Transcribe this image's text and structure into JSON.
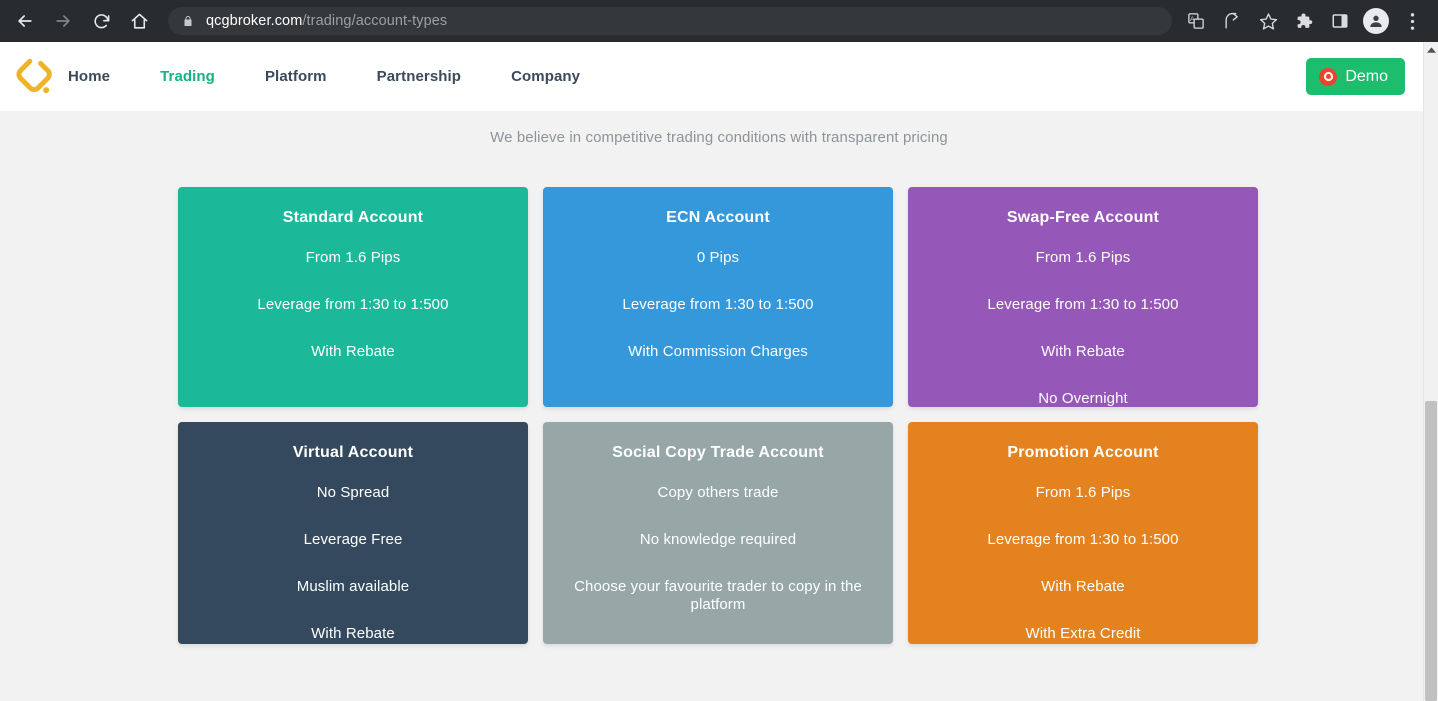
{
  "browser": {
    "back_label": "Back",
    "forward_label": "Forward",
    "reload_label": "Reload",
    "home_label": "Home",
    "url_host": "qcgbroker.com",
    "url_path": "/trading/account-types",
    "lock_icon": "lock-icon",
    "toolbar_icons": [
      "translate-icon",
      "share-icon",
      "bookmark-star-icon",
      "extensions-puzzle-icon",
      "side-panel-icon",
      "profile-avatar-icon",
      "three-dot-menu-icon"
    ]
  },
  "site_header": {
    "logo_name": "qcg-diamond-logo",
    "nav": [
      {
        "label": "Home",
        "active": false
      },
      {
        "label": "Trading",
        "active": true
      },
      {
        "label": "Platform",
        "active": false
      },
      {
        "label": "Partnership",
        "active": false
      },
      {
        "label": "Company",
        "active": false
      }
    ],
    "demo_button": {
      "label": "Demo",
      "icon": "demo-circle-icon",
      "bg_color": "#1cbd6d",
      "icon_color": "#e8452c"
    },
    "active_color": "#16b187",
    "nav_color": "#3b4a5a"
  },
  "main": {
    "subtitle": "We believe in competitive trading conditions with transparent pricing",
    "cards": [
      {
        "title": "Standard Account",
        "color": "#1bb99a",
        "features": [
          "From 1.6 Pips",
          "Leverage from 1:30 to 1:500",
          "With Rebate"
        ]
      },
      {
        "title": "ECN Account",
        "color": "#3498db",
        "features": [
          "0 Pips",
          "Leverage from 1:30 to 1:500",
          "With Commission Charges"
        ]
      },
      {
        "title": "Swap-Free Account",
        "color": "#9558b8",
        "features": [
          "From 1.6 Pips",
          "Leverage from 1:30 to 1:500",
          "With Rebate",
          "No Overnight"
        ]
      },
      {
        "title": "Virtual Account",
        "color": "#34495e",
        "features": [
          "No Spread",
          "Leverage Free",
          "Muslim available",
          "With Rebate"
        ]
      },
      {
        "title": "Social Copy Trade Account",
        "color": "#97a7a7",
        "features": [
          "Copy others trade",
          "No knowledge required",
          "Choose your favourite trader to copy in the platform"
        ]
      },
      {
        "title": "Promotion Account",
        "color": "#e3821f",
        "features": [
          "From 1.6 Pips",
          "Leverage from 1:30 to 1:500",
          "With Rebate",
          "With Extra Credit"
        ]
      }
    ]
  },
  "page_bg": "#f2f2f2"
}
